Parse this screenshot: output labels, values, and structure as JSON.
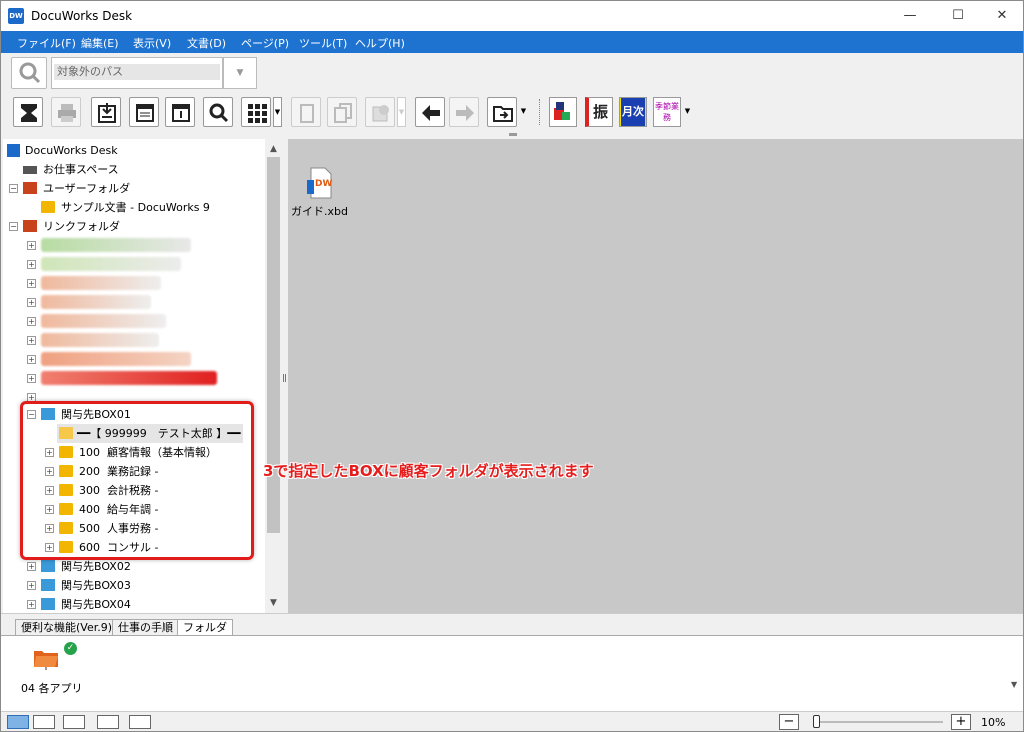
{
  "window": {
    "title": "DocuWorks Desk",
    "app_icon_text": "DW"
  },
  "menu": [
    "ファイル(F)",
    "編集(E)",
    "表示(V)",
    "文書(D)",
    "ページ(P)",
    "ツール(T)",
    "ヘルプ(H)"
  ],
  "address": {
    "placeholder": "対象外のパス"
  },
  "kanji_buttons": [
    "振",
    "月次",
    "季節業務"
  ],
  "tree": {
    "root": "DocuWorks Desk",
    "workspace": "お仕事スペース",
    "user_folder": "ユーザーフォルダ",
    "sample": "サンプル文書 - DocuWorks 9",
    "link_folder": "リンクフォルダ",
    "box01": "関与先BOX01",
    "customer": "━━【 999999　テスト太郎 】━━",
    "subfolders": [
      {
        "code": "100",
        "name": "顧客情報（基本情報）"
      },
      {
        "code": "200",
        "name": "業務記録 -"
      },
      {
        "code": "300",
        "name": "会計税務 -"
      },
      {
        "code": "400",
        "name": "給与年調 -"
      },
      {
        "code": "500",
        "name": "人事労務 -"
      },
      {
        "code": "600",
        "name": "コンサル -"
      }
    ],
    "box02": "関与先BOX02",
    "box03": "関与先BOX03",
    "box04": "関与先BOX04"
  },
  "annotation": "3で指定したBOXに顧客フォルダが表示されます",
  "main": {
    "file_name": "ガイド.xbd",
    "file_icon_text": "DW"
  },
  "tabs": [
    "便利な機能(Ver.9)",
    "仕事の手順",
    "フォルダ"
  ],
  "tab_panel": {
    "item_label": "04 各アプリ"
  },
  "status": {
    "zoom": "10%"
  },
  "colors": {
    "menubar": "#1e73d1",
    "highlight": "#e21b1b",
    "folder": "#f2b600"
  }
}
